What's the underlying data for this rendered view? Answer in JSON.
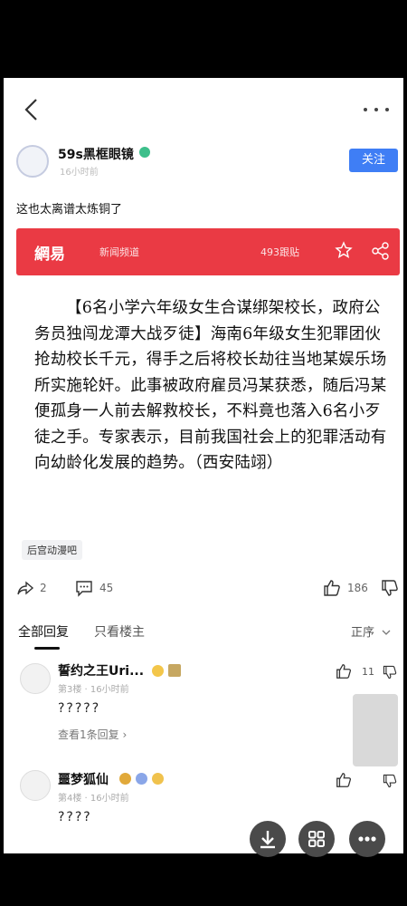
{
  "author": {
    "name": "59s黑框眼镜",
    "time": "16小时前"
  },
  "follow_label": "关注",
  "post_text": "这也太离谱太炼铜了",
  "banner": {
    "logo": "網易",
    "channel": "新闻频道",
    "count": "493跟贴"
  },
  "article": "【6名小学六年级女生合谋绑架校长，政府公务员独闯龙潭大战歹徒】海南6年级女生犯罪团伙抢劫校长千元，得手之后将校长劫往当地某娱乐场所实施轮奸。此事被政府雇员冯某获悉，随后冯某便孤身一人前去解救校长，不料竟也落入6名小歹徒之手。专家表示，目前我国社会上的犯罪活动有向幼龄化发展的趋势。（西安陆翊）",
  "forum_tag": "后宫动漫吧",
  "actions": {
    "share_count": "2",
    "comment_count": "45",
    "like_count": "186"
  },
  "tabs": {
    "all": "全部回复",
    "host_only": "只看楼主",
    "sort": "正序"
  },
  "replies": [
    {
      "name": "誓约之王Uri...",
      "meta": "第3楼 · 16小时前",
      "text": "?????",
      "view_replies": "查看1条回复",
      "likes": "11"
    },
    {
      "name": "噩梦狐仙",
      "meta": "第4楼 · 16小时前",
      "text": "????",
      "likes": ""
    }
  ]
}
